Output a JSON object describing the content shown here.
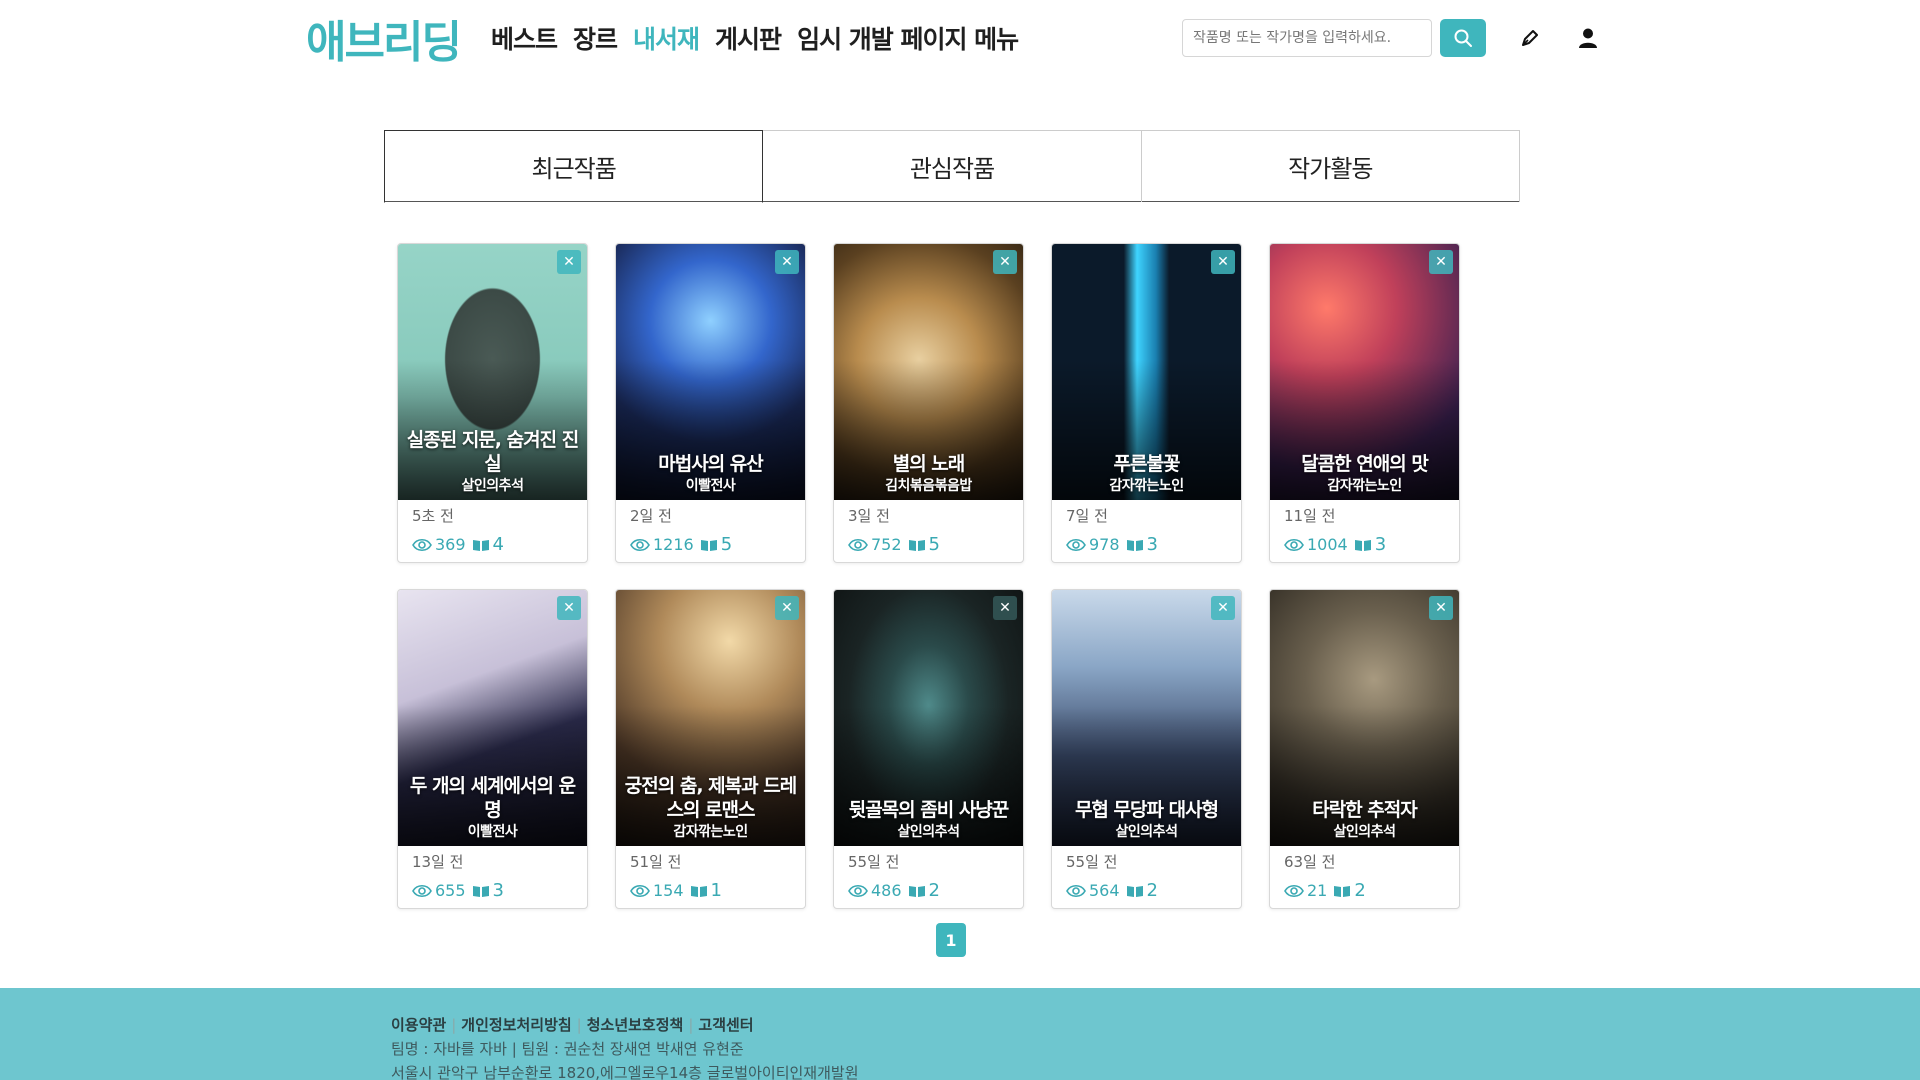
{
  "header": {
    "logo": "애브리딩",
    "nav": [
      "베스트",
      "장르",
      "내서재",
      "게시판",
      "임시 개발 페이지 메뉴"
    ],
    "active_nav": 2,
    "search_placeholder": "작품명 또는 작가명을 입력하세요.",
    "icons": [
      "search-icon",
      "pen-icon",
      "user-icon"
    ]
  },
  "tabs": [
    "최근작품",
    "관심작품",
    "작가활동"
  ],
  "active_tab": 0,
  "works": [
    {
      "title": "실종된 지문, 숨겨진 진실",
      "author": "살인의추석",
      "date": "5초 전",
      "views": "369",
      "episodes": "4"
    },
    {
      "title": "마법사의 유산",
      "author": "이빨전사",
      "date": "2일 전",
      "views": "1216",
      "episodes": "5"
    },
    {
      "title": "별의 노래",
      "author": "김치볶음볶음밥",
      "date": "3일 전",
      "views": "752",
      "episodes": "5"
    },
    {
      "title": "푸른불꽃",
      "author": "감자깎는노인",
      "date": "7일 전",
      "views": "978",
      "episodes": "3"
    },
    {
      "title": "달콤한 연애의 맛",
      "author": "감자깎는노인",
      "date": "11일 전",
      "views": "1004",
      "episodes": "3"
    },
    {
      "title": "두 개의 세계에서의 운명",
      "author": "이빨전사",
      "date": "13일 전",
      "views": "655",
      "episodes": "3"
    },
    {
      "title": "궁전의 춤, 제복과 드레스의 로맨스",
      "author": "감자깎는노인",
      "date": "51일 전",
      "views": "154",
      "episodes": "1"
    },
    {
      "title": "뒷골목의 좀비 사냥꾼",
      "author": "살인의추석",
      "date": "55일 전",
      "views": "486",
      "episodes": "2"
    },
    {
      "title": "무협 무당파 대사형",
      "author": "살인의추석",
      "date": "55일 전",
      "views": "564",
      "episodes": "2"
    },
    {
      "title": "타락한 추적자",
      "author": "살인의추석",
      "date": "63일 전",
      "views": "21",
      "episodes": "2"
    }
  ],
  "pagination": {
    "current": "1"
  },
  "footer": {
    "links": [
      "이용약관",
      "개인정보처리방침",
      "청소년보호정책",
      "고객센터"
    ],
    "team": "팀명 : 자바를 자바 | 팀원 : 권순천 장새연 박새연 유현준",
    "address": "서울시 관악구 남부순환로 1820,에그엘로우14층 글로벌아이티인재개발원"
  },
  "colors": {
    "accent": "#3fb6bd",
    "footer_bg": "#6ec6cf"
  }
}
